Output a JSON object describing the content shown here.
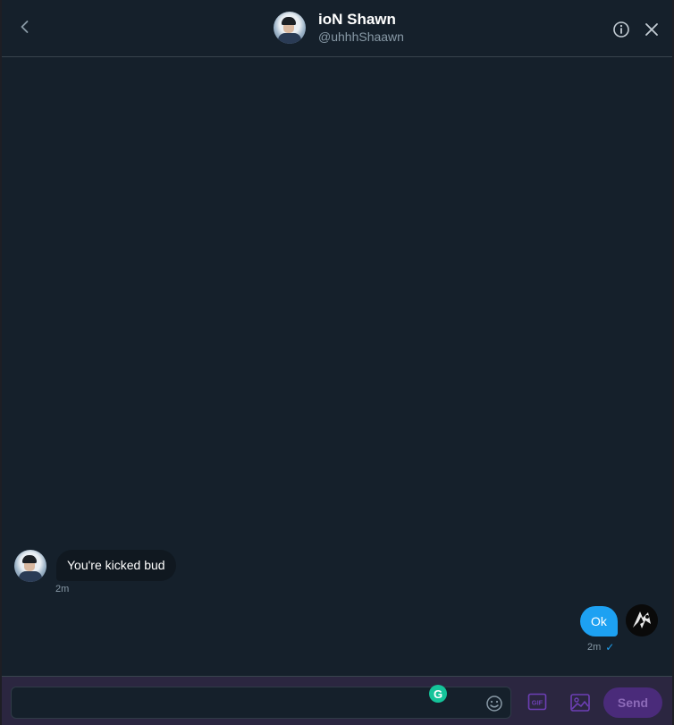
{
  "header": {
    "name": "ioN Shawn",
    "handle": "@uhhhShaawn"
  },
  "messages": [
    {
      "direction": "incoming",
      "text": "You're kicked bud",
      "time": "2m"
    },
    {
      "direction": "outgoing",
      "text": "Ok",
      "time": "2m",
      "status": "✓"
    }
  ],
  "composer": {
    "placeholder": "",
    "value": "",
    "gif_label": "GIF",
    "send_label": "Send",
    "grammarly_label": "G"
  },
  "colors": {
    "background": "#15202b",
    "accent": "#1da1f2",
    "send_disabled": "#4a2b7a",
    "incoming_bubble": "#101820"
  },
  "icons": [
    "back-arrow-icon",
    "info-icon",
    "close-icon",
    "emoji-icon",
    "gif-icon",
    "media-icon",
    "grammarly-icon"
  ]
}
